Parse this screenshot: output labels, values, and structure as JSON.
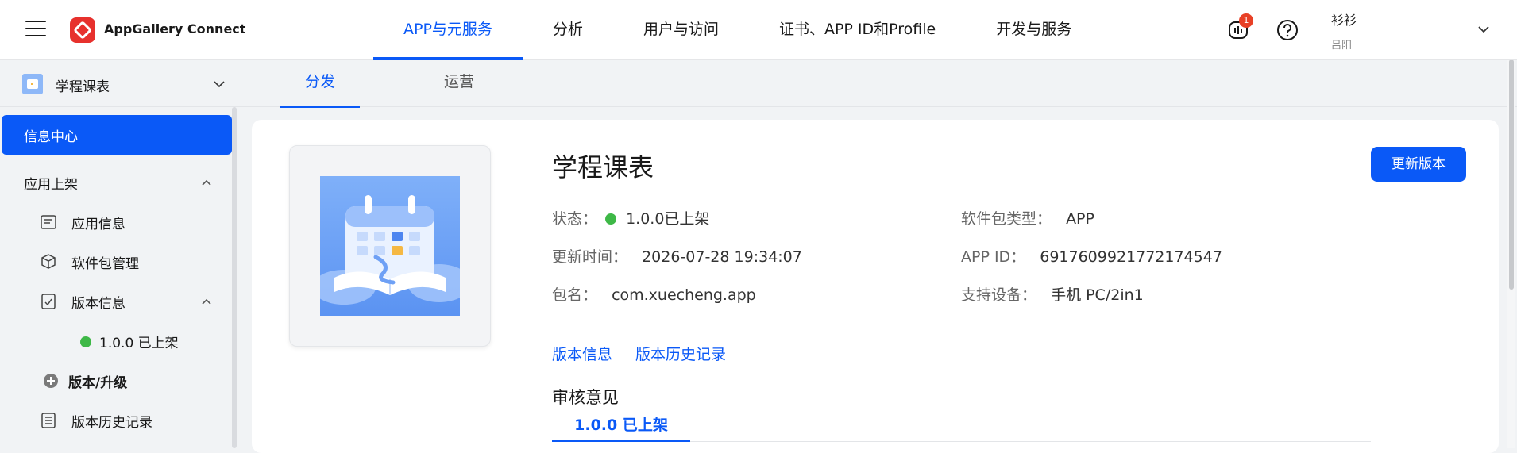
{
  "header": {
    "brand": "AppGallery Connect",
    "nav": [
      "APP与元服务",
      "分析",
      "用户与访问",
      "证书、APP ID和Profile",
      "开发与服务"
    ],
    "active_nav_index": 0,
    "notification_count": "1",
    "user_name": "衫衫",
    "user_sub": "吕阳",
    "icons": {
      "menu": "hamburger-icon",
      "logo": "appgallery-logo",
      "bell": "feedback-icon",
      "help": "help-icon",
      "dropdown": "chevron-down-icon"
    }
  },
  "app_switcher": {
    "name": "学程课表"
  },
  "subtabs": [
    "分发",
    "运营"
  ],
  "sidebar": {
    "active": "信息中心",
    "section_title": "应用上架",
    "items": [
      {
        "label": "应用信息",
        "icon": "app-info-icon"
      },
      {
        "label": "软件包管理",
        "icon": "package-icon"
      },
      {
        "label": "版本信息",
        "icon": "version-info-icon"
      }
    ],
    "version_entry": "1.0.0 已上架",
    "add_version": "版本/升级",
    "history": "版本历史记录"
  },
  "app": {
    "title": "学程课表",
    "update_button": "更新版本",
    "status_label": "状态：",
    "status_value": "1.0.0已上架",
    "package_type_label": "软件包类型：",
    "package_type_value": "APP",
    "updated_label": "更新时间：",
    "updated_value": "2026-07-28 19:34:07",
    "appid_label": "APP ID：",
    "appid_value": "6917609921772174547",
    "pkg_label": "包名：",
    "pkg_value": "com.xuecheng.app",
    "devices_label": "支持设备：",
    "devices_value": "手机 PC/2in1",
    "links": [
      "版本信息",
      "版本历史记录"
    ],
    "review_title": "审核意见",
    "review_tab": "1.0.0 已上架"
  },
  "colors": {
    "primary": "#0a59f7",
    "status_green": "#3eb847",
    "badge": "#e84026",
    "logo": "#e7312d"
  }
}
